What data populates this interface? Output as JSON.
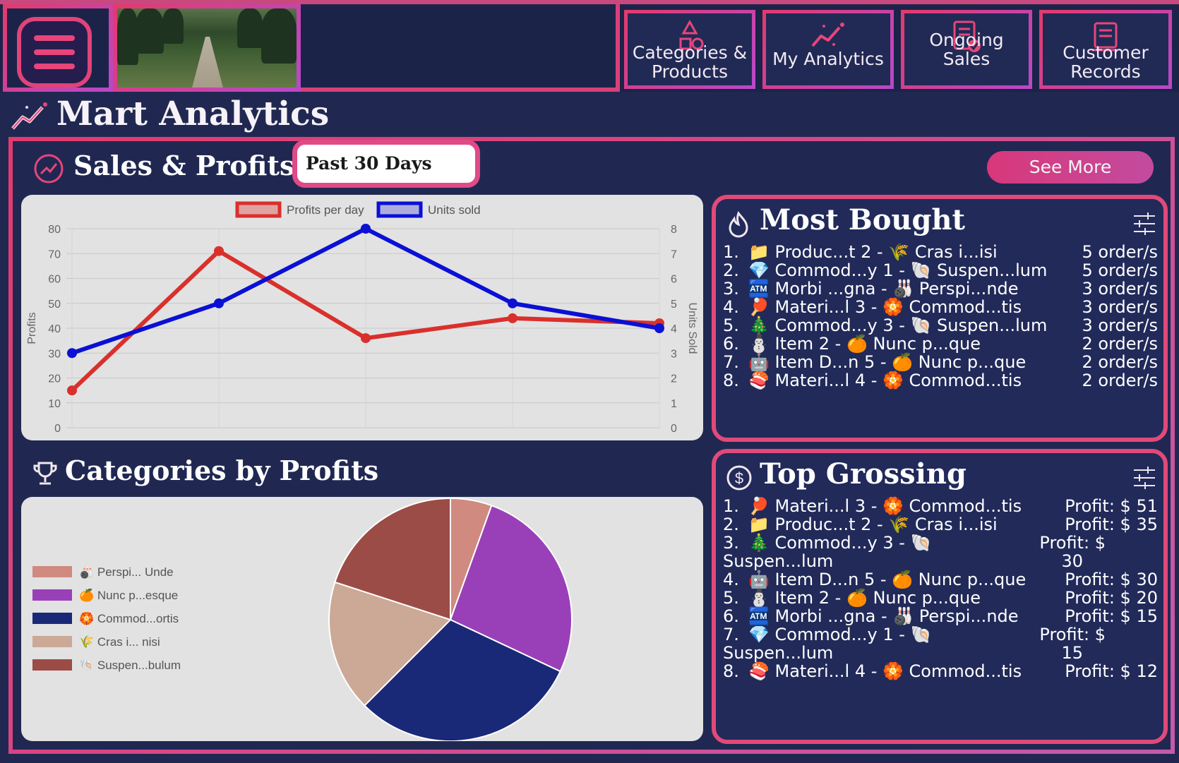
{
  "nav": {
    "tabs": [
      {
        "label_line1": "Categories &",
        "label_line2": "Products",
        "icon": "shapes-icon"
      },
      {
        "label_line1": "My Analytics",
        "label_line2": "",
        "icon": "analytics-icon"
      },
      {
        "label_line1": "Ongoing Sales",
        "label_line2": "",
        "icon": "receipt-check-icon"
      },
      {
        "label_line1": "Customer",
        "label_line2": "Records",
        "icon": "records-icon"
      }
    ]
  },
  "page": {
    "title": "Mart Analytics"
  },
  "sales": {
    "title": "Sales & Profits",
    "period": "Past 30 Days",
    "see_more": "See More"
  },
  "chart_data": [
    {
      "type": "line",
      "x": [
        1,
        2,
        3,
        4,
        5
      ],
      "series": [
        {
          "name": "Profits per day",
          "axis": "left",
          "color": "#d9302c",
          "values": [
            15,
            71,
            36,
            44,
            42
          ]
        },
        {
          "name": "Units sold",
          "axis": "right",
          "color": "#0a10d4",
          "values": [
            3,
            5,
            8,
            5,
            4
          ]
        }
      ],
      "ylabel": "Profits",
      "y2label": "Units Sold",
      "ylim": [
        0,
        80
      ],
      "y2lim": [
        0,
        8
      ],
      "yticks": [
        "0",
        "10",
        "20",
        "30",
        "40",
        "50",
        "60",
        "70",
        "80"
      ],
      "y2ticks": [
        "0",
        "1",
        "2",
        "3",
        "4",
        "5",
        "6",
        "7",
        "8"
      ],
      "grid": true,
      "legend": "top-center"
    },
    {
      "type": "pie",
      "title": "Categories by Profits",
      "labels": [
        "🎳 Perspi... Unde",
        "🍊 Nunc p...esque",
        "🏵️ Commod...ortis",
        "🌾 Cras i... nisi",
        "🐚 Suspen...bulum"
      ],
      "values": [
        5.5,
        26.5,
        30.5,
        17.5,
        20
      ],
      "colors": [
        "#d08a80",
        "#9940b8",
        "#1a2878",
        "#cca896",
        "#9c4c46"
      ],
      "legend": "left"
    }
  ],
  "most_bought": {
    "title": "Most Bought",
    "rows": [
      {
        "num": "1.",
        "text": "📁 Produc...t 2 - 🌾 Cras i...isi",
        "value": "5 order/s"
      },
      {
        "num": "2.",
        "text": "💎 Commod...y 1 - 🐚 Suspen...lum",
        "value": "5 order/s"
      },
      {
        "num": "3.",
        "text": "🏧 Morbi ...gna - 🎳 Perspi...nde",
        "value": "3 order/s"
      },
      {
        "num": "4.",
        "text": "🏓 Materi...l 3 - 🏵️ Commod...tis",
        "value": "3 order/s"
      },
      {
        "num": "5.",
        "text": "🎄 Commod...y 3 - 🐚 Suspen...lum",
        "value": "3 order/s"
      },
      {
        "num": "6.",
        "text": "⛄ Item 2 - 🍊 Nunc p...que",
        "value": "2 order/s"
      },
      {
        "num": "7.",
        "text": "🤖 Item D...n 5 - 🍊 Nunc p...que",
        "value": "2 order/s"
      },
      {
        "num": "8.",
        "text": "🍣 Materi...l 4 - 🏵️ Commod...tis",
        "value": "2 order/s"
      }
    ]
  },
  "top_grossing": {
    "title": "Top Grossing",
    "rows": [
      {
        "num": "1.",
        "text": "🏓 Materi...l 3 - 🏵️ Commod...tis",
        "value": "Profit: $ 51",
        "wrap": "",
        "wrap_value": ""
      },
      {
        "num": "2.",
        "text": "📁 Produc...t 2 - 🌾 Cras i...isi",
        "value": "Profit: $ 35",
        "wrap": "",
        "wrap_value": ""
      },
      {
        "num": "3.",
        "text": "🎄 Commod...y 3 - 🐚",
        "value": "Profit: $",
        "wrap": "Suspen...lum",
        "wrap_value": "30"
      },
      {
        "num": "4.",
        "text": "🤖 Item D...n 5 - 🍊 Nunc p...que",
        "value": "Profit: $ 30",
        "wrap": "",
        "wrap_value": ""
      },
      {
        "num": "5.",
        "text": "⛄ Item 2 - 🍊 Nunc p...que",
        "value": "Profit: $ 20",
        "wrap": "",
        "wrap_value": ""
      },
      {
        "num": "6.",
        "text": "🏧 Morbi ...gna - 🎳 Perspi...nde",
        "value": "Profit: $ 15",
        "wrap": "",
        "wrap_value": ""
      },
      {
        "num": "7.",
        "text": "💎 Commod...y 1 - 🐚",
        "value": "Profit: $",
        "wrap": "Suspen...lum",
        "wrap_value": "15"
      },
      {
        "num": "8.",
        "text": "🍣 Materi...l 4 - 🏵️ Commod...tis",
        "value": "Profit: $ 12",
        "wrap": "",
        "wrap_value": ""
      }
    ]
  },
  "colors": {
    "accent": "#e0437a",
    "panel": "#212a59",
    "background": "#202852"
  }
}
